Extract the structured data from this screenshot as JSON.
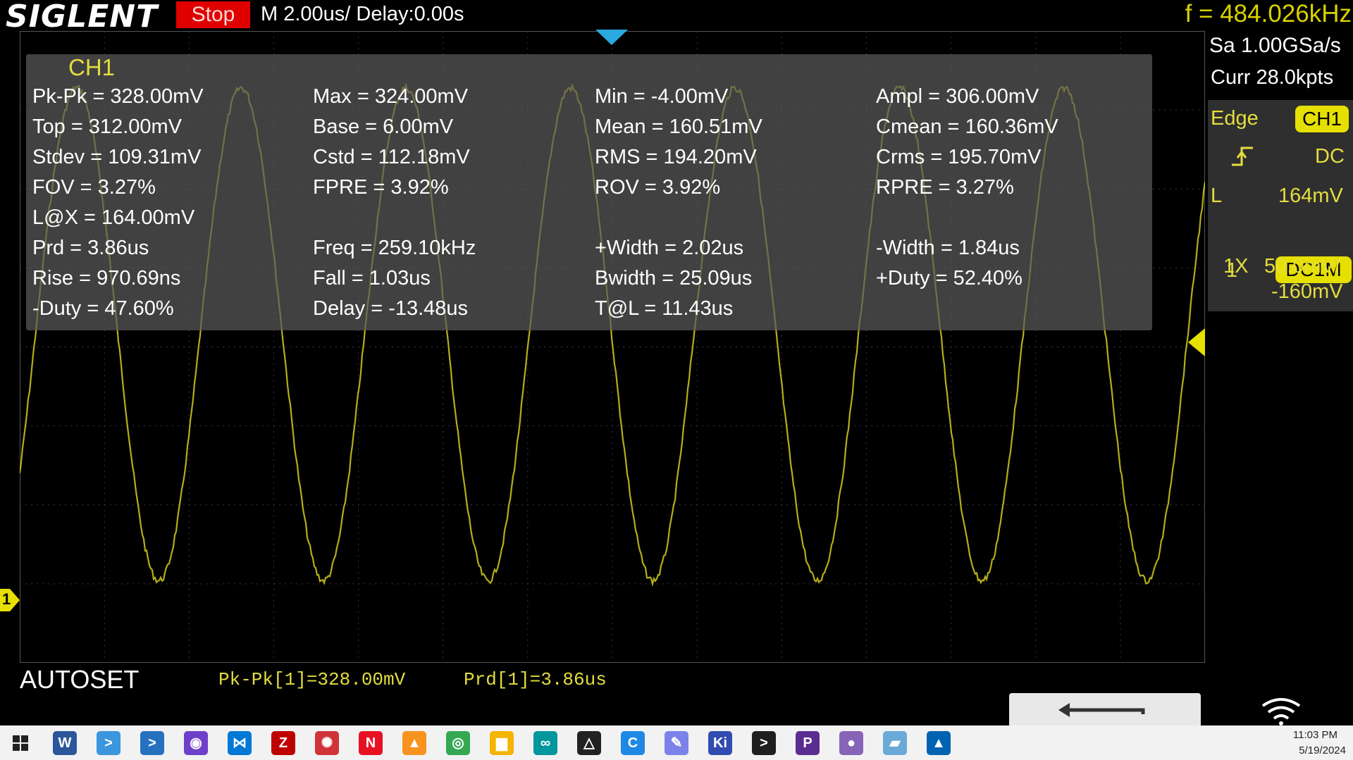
{
  "header": {
    "logo": "SIGLENT",
    "run_state": "Stop",
    "timebase": "M 2.00us/  Delay:0.00s",
    "frequency": "f = 484.026kHz"
  },
  "measurements": {
    "channel": "CH1",
    "rows": [
      [
        "Pk-Pk = 328.00mV",
        "Max = 324.00mV",
        "Min = -4.00mV",
        "Ampl = 306.00mV"
      ],
      [
        "Top = 312.00mV",
        "Base = 6.00mV",
        "Mean = 160.51mV",
        "Cmean = 160.36mV"
      ],
      [
        "Stdev = 109.31mV",
        "Cstd = 112.18mV",
        "RMS = 194.20mV",
        "Crms = 195.70mV"
      ],
      [
        "FOV = 3.27%",
        "FPRE = 3.92%",
        "ROV = 3.92%",
        "RPRE = 3.27%"
      ],
      [
        "L@X = 164.00mV",
        "",
        "",
        ""
      ],
      [
        "Prd = 3.86us",
        "Freq = 259.10kHz",
        "+Width = 2.02us",
        "-Width = 1.84us"
      ],
      [
        "Rise = 970.69ns",
        "Fall = 1.03us",
        "Bwidth = 25.09us",
        "+Duty = 52.40%"
      ],
      [
        "-Duty = 47.60%",
        "Delay = -13.48us",
        "T@L = 11.43us",
        ""
      ]
    ]
  },
  "acquisition": {
    "sample_rate": "Sa 1.00GSa/s",
    "memory": "Curr 28.0kpts"
  },
  "trigger": {
    "type": "Edge",
    "source": "CH1",
    "slope_icon": "rising-edge-icon",
    "coupling": "DC",
    "level_label": "L",
    "level": "164mV"
  },
  "channel": {
    "number": "1",
    "coupling": "DC1M",
    "probe": "1X",
    "scale": "50.0mV/",
    "offset": "-160mV"
  },
  "bottom": {
    "autoset": "AUTOSET",
    "quick_meas_1": "Pk-Pk[1]=328.00mV",
    "quick_meas_2": "Prd[1]=3.86us"
  },
  "marker_labels": {
    "channel_ground": "1"
  },
  "waveform": {
    "color": "#d4cd1c",
    "cycles_visible": 7.2,
    "high": "324.00mV",
    "low": "-4.00mV"
  },
  "taskbar": {
    "time": "11:03 PM",
    "date": "5/19/2024",
    "apps": [
      {
        "name": "word-icon",
        "glyph": "W",
        "color": "#2b579a"
      },
      {
        "name": "terminal-app-icon",
        "glyph": ">",
        "color": "#3a96dd"
      },
      {
        "name": "powershell-icon",
        "glyph": ">",
        "color": "#2671be"
      },
      {
        "name": "github-icon",
        "glyph": "◉",
        "color": "#6e40c9"
      },
      {
        "name": "vscode-icon",
        "glyph": "⋈",
        "color": "#0078d4"
      },
      {
        "name": "filezilla-icon",
        "glyph": "Z",
        "color": "#bf0000"
      },
      {
        "name": "app-red-icon",
        "glyph": "✺",
        "color": "#d13438"
      },
      {
        "name": "app-red2-icon",
        "glyph": "N",
        "color": "#e81123"
      },
      {
        "name": "vlc-icon",
        "glyph": "▲",
        "color": "#f7931e"
      },
      {
        "name": "chrome-icon",
        "glyph": "◎",
        "color": "#34a853"
      },
      {
        "name": "file-explorer-icon",
        "glyph": "▆",
        "color": "#f4b400"
      },
      {
        "name": "arduino-icon",
        "glyph": "∞",
        "color": "#00979d"
      },
      {
        "name": "inkscape-icon",
        "glyph": "△",
        "color": "#222222"
      },
      {
        "name": "app-c-icon",
        "glyph": "C",
        "color": "#1e88e5"
      },
      {
        "name": "app-chat-icon",
        "glyph": "✎",
        "color": "#7b83eb"
      },
      {
        "name": "kicad-icon",
        "glyph": "Ki",
        "color": "#314cb0"
      },
      {
        "name": "terminal-dark-icon",
        "glyph": ">",
        "color": "#1f1f1f"
      },
      {
        "name": "app-p-icon",
        "glyph": "P",
        "color": "#5c2d91"
      },
      {
        "name": "app-globe-icon",
        "glyph": "●",
        "color": "#8764b8"
      },
      {
        "name": "app-book-icon",
        "glyph": "▰",
        "color": "#6aa9d8"
      },
      {
        "name": "app-photo-icon",
        "glyph": "▲",
        "color": "#0063b1"
      }
    ]
  }
}
